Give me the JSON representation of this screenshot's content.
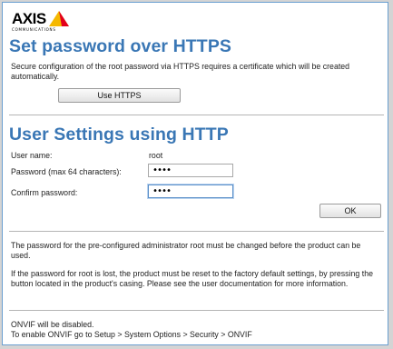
{
  "brand": {
    "name": "AXIS",
    "sub": "COMMUNICATIONS"
  },
  "https_section": {
    "title": "Set password over HTTPS",
    "description": "Secure configuration of the root password via HTTPS requires a certificate which will be created automatically.",
    "button_label": "Use HTTPS"
  },
  "http_section": {
    "title": "User Settings using HTTP",
    "username_label": "User name:",
    "username_value": "root",
    "password_label": "Password (max 64 characters):",
    "password_value": "••••",
    "confirm_label": "Confirm password:",
    "confirm_value": "••••",
    "ok_label": "OK"
  },
  "notes": {
    "change_required": "The password for the pre-configured administrator root must be changed before the product can be used.",
    "reset_info": "If the password for root is lost, the product must be reset to the factory default settings, by pressing the button located in the product's casing. Please see the user documentation for more information."
  },
  "onvif": {
    "line1": "ONVIF will be disabled.",
    "line2": "To enable ONVIF go to Setup > System Options > Security > ONVIF"
  },
  "colors": {
    "heading": "#3a77b5",
    "border": "#6a9fd0",
    "logo_triangle": "#f5b800",
    "logo_accent": "#e3001b"
  }
}
